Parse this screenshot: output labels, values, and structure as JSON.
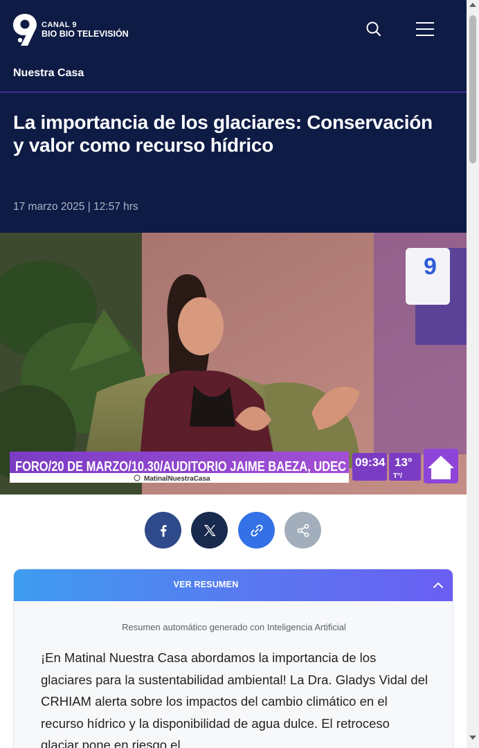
{
  "header": {
    "brand_line1": "CANAL 9",
    "brand_line2": "BIO BIO TELEVISIÓN",
    "icons": [
      "canal9-logo-icon",
      "search-icon",
      "hamburger-menu-icon"
    ]
  },
  "section": {
    "label": "Nuestra Casa"
  },
  "article": {
    "title": "La importancia de los glaciares: Conservación y valor como recurso hídrico",
    "date": "17 marzo 2025 | 12:57 hrs"
  },
  "video_frame": {
    "ticker_text": "FORO/20 DE MARZO/10.30/AUDITORIO JAIME BAEZA, UDEC",
    "instagram_handle": "MatinalNuestraCasa",
    "clock": "09:34",
    "temperature": "13°",
    "temperature_unit": "T°/",
    "corner_logo": "9"
  },
  "share": {
    "icons": [
      "facebook-icon",
      "x-icon",
      "link-icon",
      "share-icon"
    ]
  },
  "summary": {
    "toggle_label": "VER RESUMEN",
    "ai_note": "Resumen automático generado con Inteligencia Artificial",
    "text": "¡En Matinal Nuestra Casa abordamos la importancia de los glaciares para la sustentabilidad ambiental! La Dra. Gladys Vidal del CRHIAM alerta sobre los impactos del cambio climático en el recurso hídrico y la disponibilidad de agua dulce. El retroceso glaciar pone en riesgo el"
  },
  "colors": {
    "header_bg": "#0e1b45",
    "section_underline": "#3b2e9a",
    "facebook": "#2f4a8a",
    "x": "#182a4d",
    "link": "#3571e6",
    "share": "#a2aebb",
    "summary_gradient_start": "#3e9cf0",
    "summary_gradient_end": "#6a5ef2"
  }
}
